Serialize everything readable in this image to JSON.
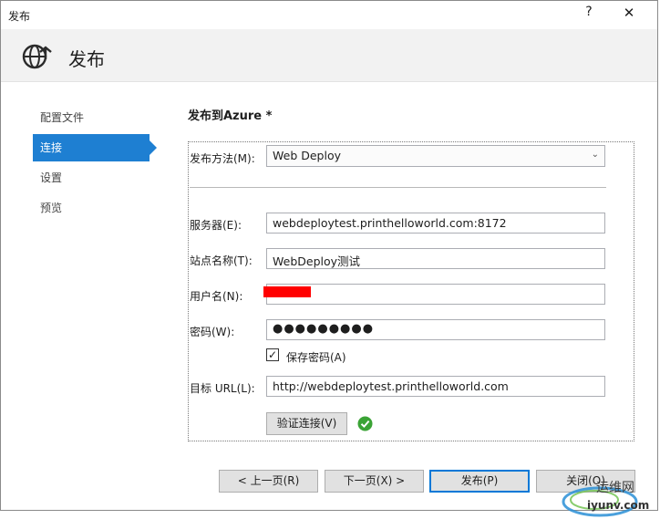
{
  "window": {
    "title": "发布",
    "help_label": "?",
    "close_label": "✕"
  },
  "header": {
    "title": "发布"
  },
  "nav": {
    "items": [
      {
        "label": "配置文件",
        "active": false
      },
      {
        "label": "连接",
        "active": true
      },
      {
        "label": "设置",
        "active": false
      },
      {
        "label": "预览",
        "active": false
      }
    ]
  },
  "form": {
    "section_title": "发布到Azure *",
    "method_label": "发布方法(M):",
    "method_value": "Web Deploy",
    "server_label": "服务器(E):",
    "server_value": "webdeploytest.printhelloworld.com:8172",
    "site_label": "站点名称(T):",
    "site_value": "WebDeploy测试",
    "user_label": "用户名(N):",
    "user_value": "",
    "password_label": "密码(W):",
    "password_value": "●●●●●●●●●",
    "save_password_label": "保存密码(A)",
    "save_password_checked": true,
    "url_label": "目标 URL(L):",
    "url_value": "http://webdeploytest.printhelloworld.com",
    "verify_label": "验证连接(V)",
    "verify_status": "success"
  },
  "footer": {
    "prev_label": "< 上一页(R)",
    "next_label": "下一页(X) >",
    "publish_label": "发布(P)",
    "close_label": "关闭(O)"
  },
  "watermark": {
    "line1": "运维网",
    "line2": "iyunv.com"
  },
  "colors": {
    "accent": "#1e7fd2",
    "success": "#3aa335",
    "redaction": "#ff0000"
  }
}
